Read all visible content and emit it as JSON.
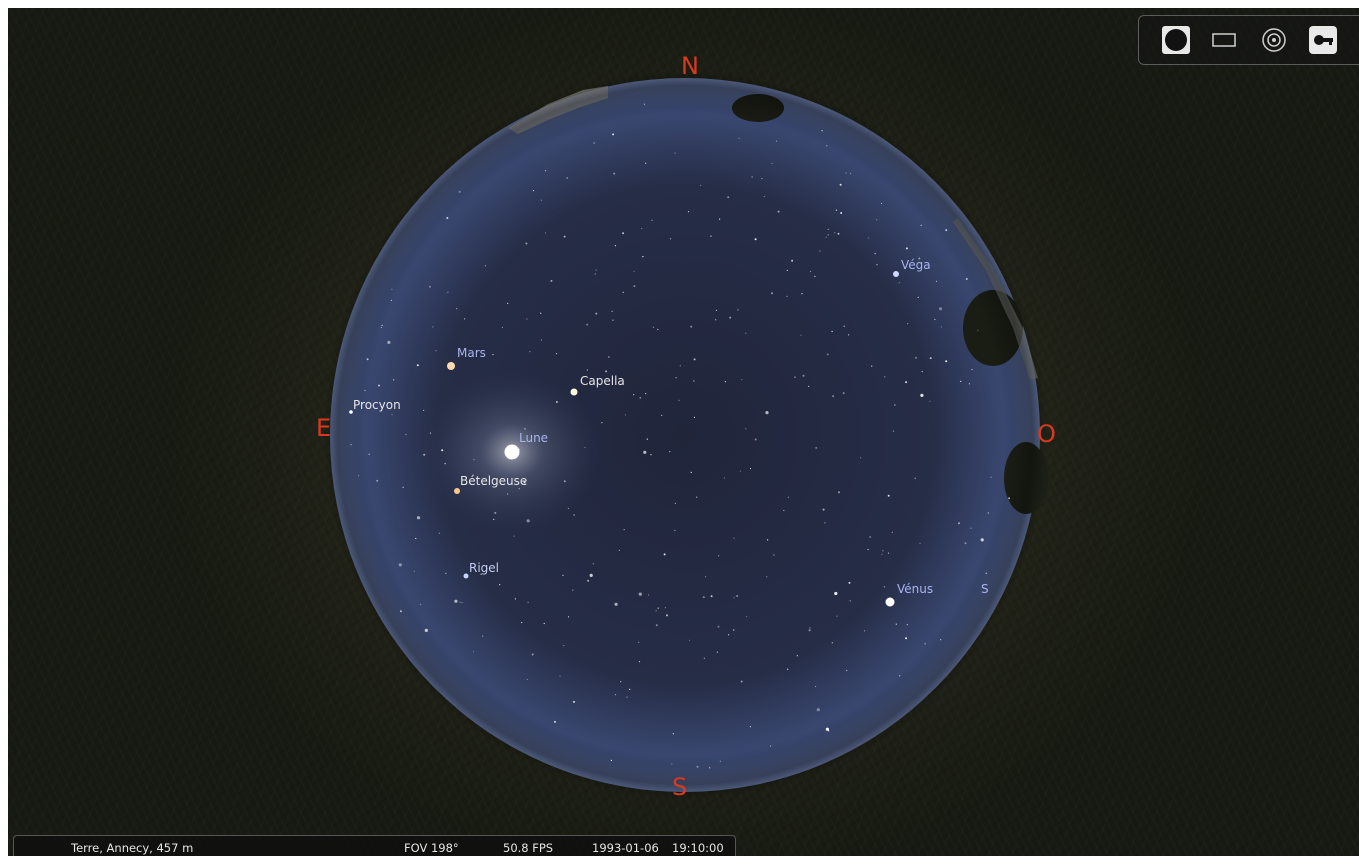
{
  "compass": {
    "north": "N",
    "south": "S",
    "east": "E",
    "west": "O"
  },
  "labels": {
    "vega": "Véga",
    "mars": "Mars",
    "capella": "Capella",
    "procyon": "Procyon",
    "lune": "Lune",
    "betelgeuse": "Bételgeuse",
    "rigel": "Rigel",
    "venus": "Vénus",
    "partial": "S"
  },
  "toolbar": {
    "icons": [
      "disk-icon",
      "rectangle-icon",
      "target-icon",
      "key-icon"
    ]
  },
  "status": {
    "location": "Terre, Annecy, 457 m",
    "fov": "FOV 198°",
    "fps": "50.8 FPS",
    "date": "1993-01-06",
    "time": "19:10:00"
  },
  "colors": {
    "compass": "#d83a1e",
    "sky_center": "#22283a",
    "sky_edge": "#4a5a86",
    "planet_label": "#a9b4ee",
    "star_label": "#e6e6e6"
  }
}
